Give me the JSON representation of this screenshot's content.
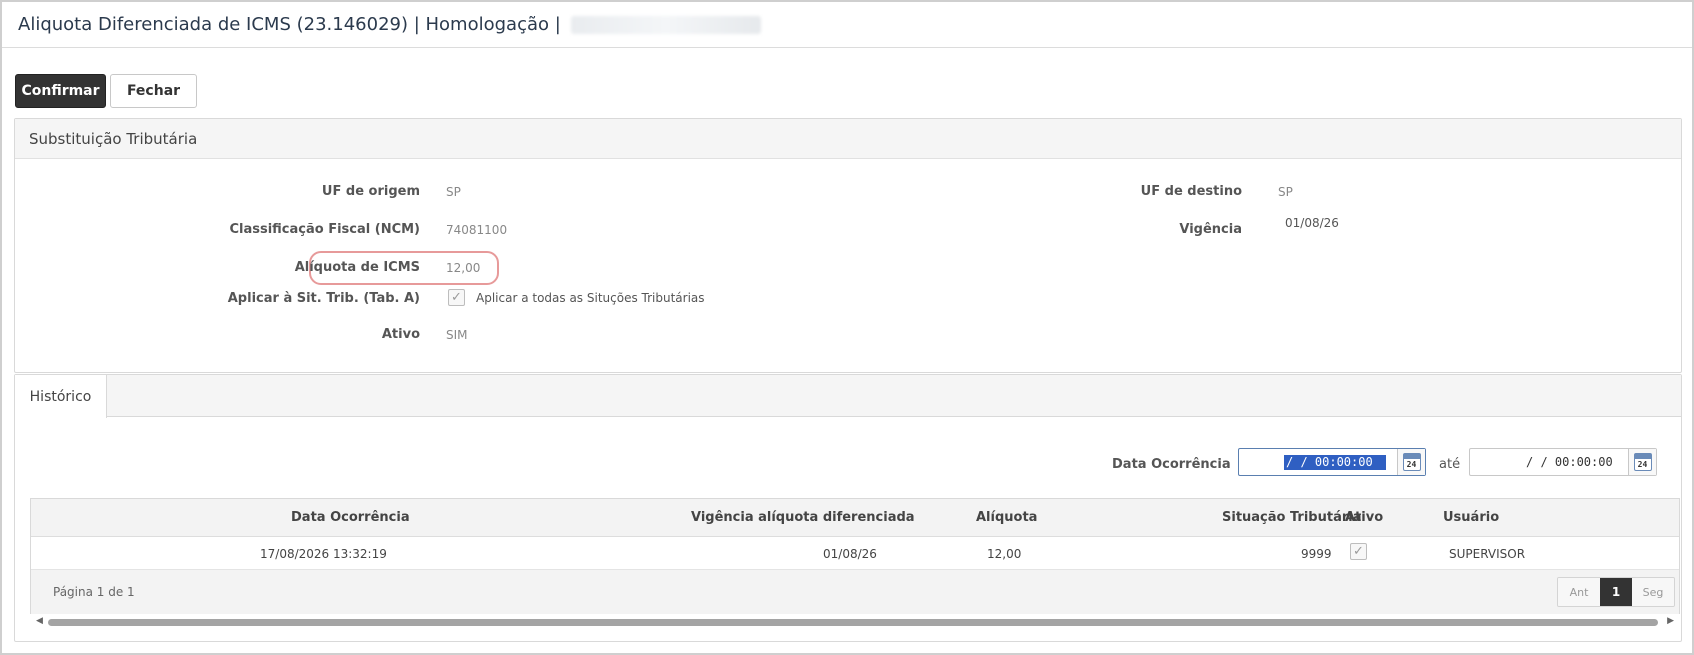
{
  "window": {
    "title": "Aliquota Diferenciada de ICMS (23.146029) | Homologação |"
  },
  "toolbar": {
    "confirm_label": "Confirmar",
    "close_label": "Fechar"
  },
  "panel": {
    "title": "Substituição Tributária",
    "fields": {
      "uf_origem_label": "UF de origem",
      "uf_origem_value": "SP",
      "ncm_label": "Classificação Fiscal (NCM)",
      "ncm_value": "74081100",
      "aliquota_label": "Alíquota de ICMS",
      "aliquota_value": "12,00",
      "aplicar_label": "Aplicar à Sit. Trib. (Tab. A)",
      "aplicar_checkbox_text": "Aplicar a todas as Situções Tributárias",
      "aplicar_checked": true,
      "ativo_label": "Ativo",
      "ativo_value": "SIM",
      "uf_destino_label": "UF de destino",
      "uf_destino_value": "SP",
      "vigencia_label": "Vigência",
      "vigencia_value": "01/08/26"
    }
  },
  "history": {
    "tab_label": "Histórico",
    "filter": {
      "label": "Data Ocorrência",
      "from_value": "/  /    00:00:00",
      "until_label": "até",
      "to_value": "/  /    00:00:00",
      "calendar_day": "24"
    },
    "columns": [
      "Data Ocorrência",
      "Vigência alíquota diferenciada",
      "Alíquota",
      "Situação Tributária",
      "Ativo",
      "Usuário"
    ],
    "rows": [
      {
        "data_ocorrencia": "17/08/2026 13:32:19",
        "vigencia": "01/08/26",
        "aliquota": "12,00",
        "situacao": "9999",
        "ativo": true,
        "usuario": "SUPERVISOR"
      }
    ],
    "pager": {
      "text": "Página 1 de 1",
      "prev": "Ant",
      "current": "1",
      "next": "Seg"
    }
  }
}
